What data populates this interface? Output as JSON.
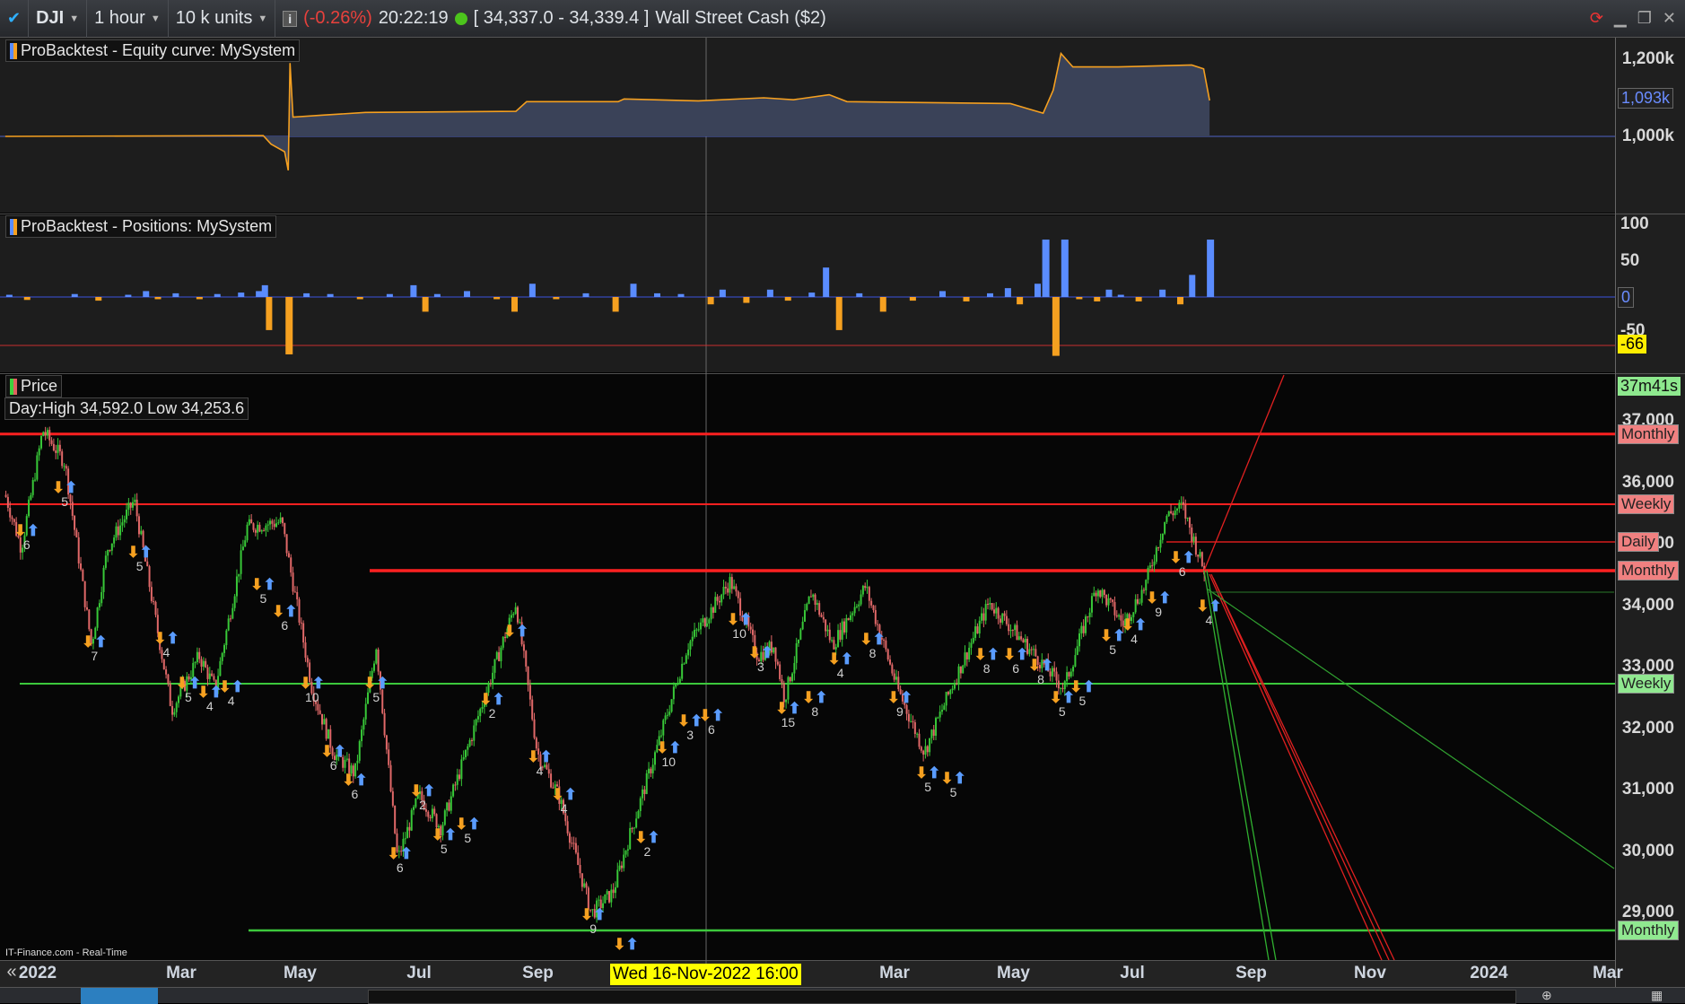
{
  "topbar": {
    "symbol": "DJI",
    "timeframe": "1 hour",
    "units": "10 k units",
    "change": "(-0.26%)",
    "time": "20:22:19",
    "bid_ask": "[ 34,337.0 - 34,339.4 ]",
    "instrument": "Wall Street Cash ($2)",
    "change_color": "#e8413c"
  },
  "panels": {
    "equity_title": "ProBacktest - Equity curve: MySystem",
    "positions_title": "ProBacktest - Positions: MySystem",
    "price_title": "Price",
    "day_range": "Day:High 34,592.0 Low 34,253.6",
    "source": "IT-Finance.com - Real-Time",
    "countdown": "37m41s",
    "cursor_date": "Wed 16-Nov-2022 16:00"
  },
  "equity_axis": {
    "ticks": [
      "1,200k",
      "1,000k"
    ],
    "current": "1,093k"
  },
  "positions_axis": {
    "ticks": [
      "100",
      "50",
      "0",
      "-50"
    ],
    "current": "-66"
  },
  "price_axis": {
    "ticks": [
      "37,000",
      "36,000",
      "35,000",
      "34,000",
      "33,000",
      "32,000",
      "31,000",
      "30,000",
      "29,000"
    ]
  },
  "levels": [
    {
      "label": "Monthly",
      "price": 36800,
      "color": "#ff2020",
      "kind": "red"
    },
    {
      "label": "Weekly",
      "price": 35657,
      "color": "#ff2020",
      "kind": "red"
    },
    {
      "label": "Daily",
      "price": 35044,
      "color": "#ff2020",
      "kind": "red"
    },
    {
      "label": "Monthly",
      "price": 34577,
      "color": "#ff2020",
      "kind": "red"
    },
    {
      "label": "Weekly",
      "price": 32737,
      "color": "#3cc83c",
      "kind": "green"
    },
    {
      "label": "Monthly",
      "price": 28723,
      "color": "#3cc83c",
      "kind": "green"
    }
  ],
  "time_axis": [
    {
      "m": 0,
      "label": "2022"
    },
    {
      "m": 2,
      "label": "Mar"
    },
    {
      "m": 4,
      "label": "May"
    },
    {
      "m": 6,
      "label": "Jul"
    },
    {
      "m": 8,
      "label": "Sep"
    },
    {
      "m": 14,
      "label": "Mar"
    },
    {
      "m": 16,
      "label": "May"
    },
    {
      "m": 18,
      "label": "Jul"
    },
    {
      "m": 20,
      "label": "Sep"
    },
    {
      "m": 22,
      "label": "Nov"
    },
    {
      "m": 24,
      "label": "2024"
    },
    {
      "m": 26,
      "label": "Mar"
    }
  ],
  "chart_data": {
    "type": "line",
    "equity": [
      [
        -0.96,
        1000
      ],
      [
        3.38,
        1002
      ],
      [
        3.51,
        980
      ],
      [
        3.74,
        960
      ],
      [
        3.8,
        912
      ],
      [
        3.83,
        1190
      ],
      [
        3.88,
        1050
      ],
      [
        4.38,
        1055
      ],
      [
        5.1,
        1062
      ],
      [
        7.63,
        1065
      ],
      [
        7.81,
        1090
      ],
      [
        9.35,
        1090
      ],
      [
        9.45,
        1097
      ],
      [
        10.7,
        1092
      ],
      [
        11.8,
        1100
      ],
      [
        12.3,
        1095
      ],
      [
        12.9,
        1108
      ],
      [
        13.2,
        1090
      ],
      [
        15.95,
        1085
      ],
      [
        16.5,
        1060
      ],
      [
        16.67,
        1120
      ],
      [
        16.8,
        1215
      ],
      [
        17.0,
        1180
      ],
      [
        17.76,
        1180
      ],
      [
        19.0,
        1185
      ],
      [
        19.2,
        1175
      ],
      [
        19.3,
        1093
      ]
    ],
    "positions": [
      [
        -0.9,
        3
      ],
      [
        -0.6,
        -4
      ],
      [
        0.2,
        4
      ],
      [
        0.6,
        -5
      ],
      [
        1.1,
        3
      ],
      [
        1.4,
        8
      ],
      [
        1.6,
        -3
      ],
      [
        1.9,
        5
      ],
      [
        2.3,
        -3
      ],
      [
        2.6,
        4
      ],
      [
        3.0,
        6
      ],
      [
        3.3,
        8
      ],
      [
        3.4,
        16
      ],
      [
        3.47,
        -45
      ],
      [
        3.8,
        -78
      ],
      [
        4.1,
        5
      ],
      [
        4.5,
        4
      ],
      [
        5.0,
        -3
      ],
      [
        5.5,
        4
      ],
      [
        5.9,
        16
      ],
      [
        6.1,
        -20
      ],
      [
        6.3,
        4
      ],
      [
        6.8,
        8
      ],
      [
        7.3,
        -3
      ],
      [
        7.6,
        -20
      ],
      [
        7.9,
        18
      ],
      [
        8.3,
        -3
      ],
      [
        8.8,
        5
      ],
      [
        9.3,
        -20
      ],
      [
        9.6,
        18
      ],
      [
        10.0,
        5
      ],
      [
        10.4,
        4
      ],
      [
        10.9,
        -10
      ],
      [
        11.1,
        10
      ],
      [
        11.5,
        -8
      ],
      [
        11.9,
        10
      ],
      [
        12.2,
        -5
      ],
      [
        12.6,
        6
      ],
      [
        12.84,
        40
      ],
      [
        13.06,
        -45
      ],
      [
        13.4,
        5
      ],
      [
        13.8,
        -20
      ],
      [
        14.3,
        -5
      ],
      [
        14.8,
        8
      ],
      [
        15.2,
        -6
      ],
      [
        15.6,
        5
      ],
      [
        15.9,
        12
      ],
      [
        16.1,
        -10
      ],
      [
        16.4,
        18
      ],
      [
        16.53,
        78
      ],
      [
        16.7,
        -80
      ],
      [
        16.85,
        78
      ],
      [
        17.1,
        -3
      ],
      [
        17.4,
        -6
      ],
      [
        17.6,
        10
      ],
      [
        17.8,
        3
      ],
      [
        18.1,
        -6
      ],
      [
        18.5,
        10
      ],
      [
        18.8,
        -10
      ],
      [
        19.0,
        30
      ],
      [
        19.3,
        78
      ]
    ],
    "price": [
      [
        -0.96,
        35810
      ],
      [
        -0.69,
        34940
      ],
      [
        -0.33,
        36860
      ],
      [
        0.04,
        36340
      ],
      [
        0.49,
        33360
      ],
      [
        0.76,
        34940
      ],
      [
        1.21,
        35720
      ],
      [
        1.84,
        32310
      ],
      [
        2.3,
        33190
      ],
      [
        2.57,
        32660
      ],
      [
        3.11,
        35290
      ],
      [
        3.69,
        35370
      ],
      [
        4.2,
        32660
      ],
      [
        4.56,
        31620
      ],
      [
        4.92,
        31270
      ],
      [
        5.28,
        33360
      ],
      [
        5.64,
        29870
      ],
      [
        6.0,
        30920
      ],
      [
        6.37,
        30390
      ],
      [
        6.91,
        31960
      ],
      [
        7.63,
        34060
      ],
      [
        7.99,
        31620
      ],
      [
        8.35,
        30920
      ],
      [
        8.9,
        29000
      ],
      [
        9.26,
        29340
      ],
      [
        9.53,
        30220
      ],
      [
        9.98,
        31620
      ],
      [
        10.52,
        33360
      ],
      [
        11.24,
        34410
      ],
      [
        11.7,
        33190
      ],
      [
        11.97,
        33360
      ],
      [
        12.15,
        32490
      ],
      [
        12.6,
        34240
      ],
      [
        12.96,
        33360
      ],
      [
        13.51,
        34320
      ],
      [
        14.05,
        32660
      ],
      [
        14.5,
        31620
      ],
      [
        14.95,
        32660
      ],
      [
        15.59,
        34060
      ],
      [
        16.22,
        33360
      ],
      [
        16.85,
        32660
      ],
      [
        17.4,
        34320
      ],
      [
        17.85,
        33710
      ],
      [
        18.21,
        34320
      ],
      [
        18.57,
        35460
      ],
      [
        18.84,
        35630
      ],
      [
        19.2,
        34590
      ]
    ],
    "signals": [
      [
        -0.6,
        35199,
        "6"
      ],
      [
        0.04,
        35899,
        "5"
      ],
      [
        0.54,
        33399,
        "7"
      ],
      [
        1.3,
        34850,
        "5"
      ],
      [
        1.75,
        33451,
        "4"
      ],
      [
        2.12,
        32717,
        "5"
      ],
      [
        2.48,
        32577,
        "4"
      ],
      [
        2.84,
        32664,
        "4"
      ],
      [
        3.38,
        34325,
        "5"
      ],
      [
        3.74,
        33888,
        "6"
      ],
      [
        4.2,
        32717,
        "10"
      ],
      [
        4.56,
        31615,
        "6"
      ],
      [
        4.92,
        31143,
        "6"
      ],
      [
        5.28,
        32717,
        "5"
      ],
      [
        5.68,
        29955,
        "6"
      ],
      [
        6.06,
        30968,
        "2"
      ],
      [
        6.42,
        30252,
        "5"
      ],
      [
        6.82,
        30427,
        "5"
      ],
      [
        7.23,
        32455,
        "2"
      ],
      [
        7.63,
        33573,
        ""
      ],
      [
        8.03,
        31528,
        "4"
      ],
      [
        8.44,
        30916,
        "4"
      ],
      [
        8.93,
        28958,
        "9"
      ],
      [
        9.48,
        28469,
        ""
      ],
      [
        9.84,
        30217,
        "2"
      ],
      [
        10.2,
        31668,
        "10"
      ],
      [
        10.56,
        32105,
        "3"
      ],
      [
        10.92,
        32192,
        "6"
      ],
      [
        11.39,
        33766,
        "10"
      ],
      [
        11.75,
        33224,
        "3"
      ],
      [
        12.21,
        32315,
        "15"
      ],
      [
        12.66,
        32490,
        "8"
      ],
      [
        13.09,
        33119,
        "4"
      ],
      [
        13.63,
        33434,
        "8"
      ],
      [
        14.09,
        32490,
        "9"
      ],
      [
        14.56,
        31266,
        "5"
      ],
      [
        14.99,
        31178,
        "5"
      ],
      [
        15.55,
        33189,
        "8"
      ],
      [
        16.04,
        33189,
        "6"
      ],
      [
        16.46,
        33014,
        "8"
      ],
      [
        16.82,
        32490,
        "5"
      ],
      [
        17.16,
        32664,
        "5"
      ],
      [
        17.67,
        33503,
        "5"
      ],
      [
        18.03,
        33678,
        "4"
      ],
      [
        18.44,
        34115,
        "9"
      ],
      [
        18.84,
        34762,
        "6"
      ],
      [
        19.29,
        33976,
        "4"
      ]
    ],
    "ylim": [
      28500,
      37400
    ]
  }
}
